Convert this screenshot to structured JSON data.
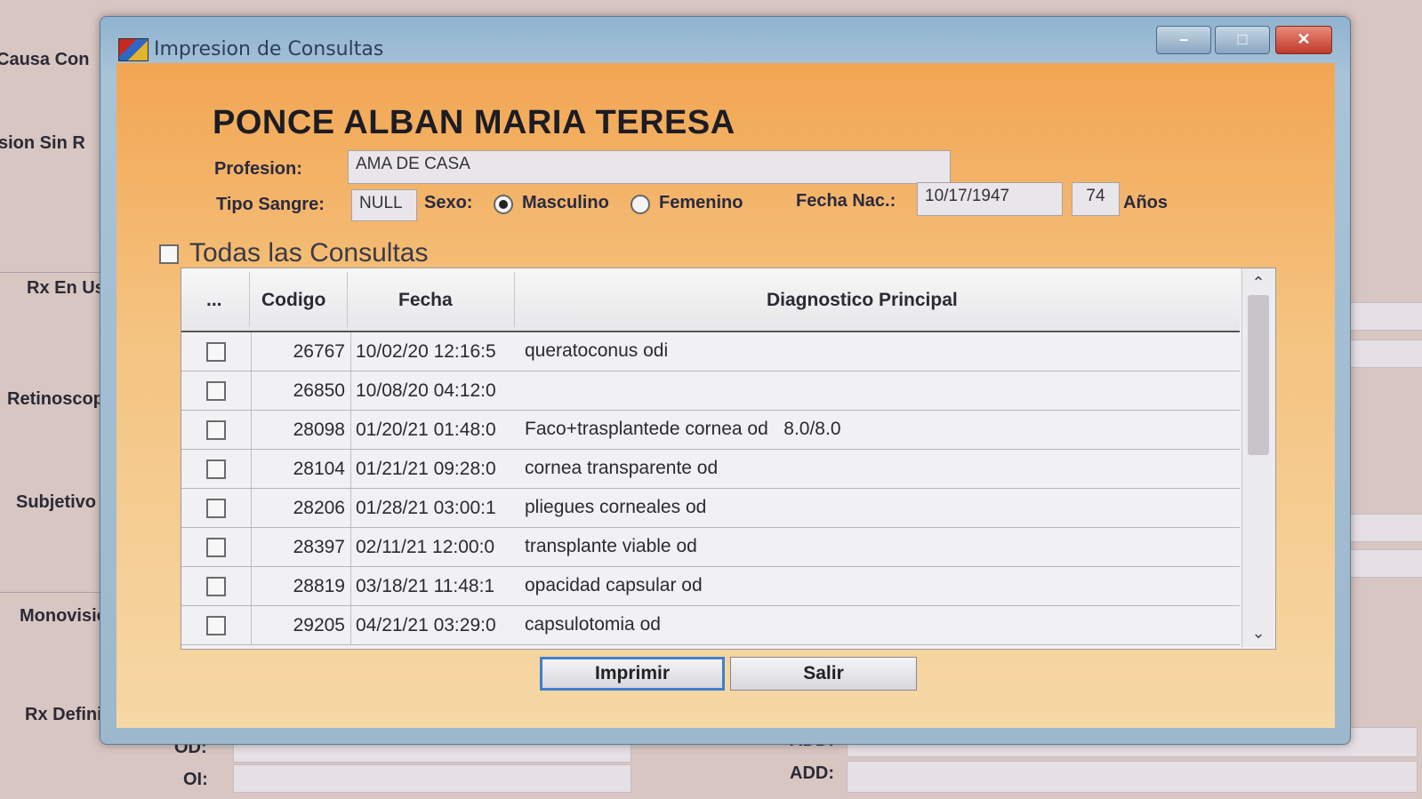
{
  "background": {
    "labels": [
      "Causa Con",
      "sion  Sin R",
      "Rx En Us",
      "Retinoscop",
      "Subjetivo",
      "Monovision",
      "Rx Definit."
    ],
    "od_label": "OD:",
    "oi_label": "OI:",
    "add_label_1": "ADD:",
    "add_label_2": "ADD:"
  },
  "window": {
    "title": "Impresion de Consultas",
    "minimize": "–",
    "maximize": "□",
    "close": "✕"
  },
  "patient": {
    "name": "PONCE ALBAN MARIA TERESA",
    "profesion_label": "Profesion:",
    "profesion": "AMA DE CASA",
    "tipo_sangre_label": "Tipo Sangre:",
    "tipo_sangre": "NULL",
    "sexo_label": "Sexo:",
    "sexo_options": [
      "Masculino",
      "Femenino"
    ],
    "sexo_selected": "Masculino",
    "fecha_nac_label": "Fecha Nac.:",
    "fecha_nac": "10/17/1947",
    "edad": "74",
    "edad_unit": "Años"
  },
  "todas_label": "Todas las Consultas",
  "table": {
    "headers": [
      "...",
      "Codigo",
      "Fecha",
      "Diagnostico Principal"
    ],
    "rows": [
      {
        "codigo": "26767",
        "fecha": "10/02/20 12:16:5",
        "diag": "queratoconus odi"
      },
      {
        "codigo": "26850",
        "fecha": "10/08/20 04:12:0",
        "diag": ""
      },
      {
        "codigo": "28098",
        "fecha": "01/20/21 01:48:0",
        "diag": "Faco+trasplantede cornea od   8.0/8.0"
      },
      {
        "codigo": "28104",
        "fecha": "01/21/21 09:28:0",
        "diag": "cornea transparente od"
      },
      {
        "codigo": "28206",
        "fecha": "01/28/21 03:00:1",
        "diag": "pliegues corneales od"
      },
      {
        "codigo": "28397",
        "fecha": "02/11/21 12:00:0",
        "diag": "transplante viable od"
      },
      {
        "codigo": "28819",
        "fecha": "03/18/21 11:48:1",
        "diag": "opacidad capsular od"
      },
      {
        "codigo": "29205",
        "fecha": "04/21/21 03:29:0",
        "diag": "capsulotomia od"
      }
    ]
  },
  "buttons": {
    "imprimir": "Imprimir",
    "salir": "Salir"
  },
  "scroll": {
    "up": "⌃",
    "down": "⌄"
  }
}
